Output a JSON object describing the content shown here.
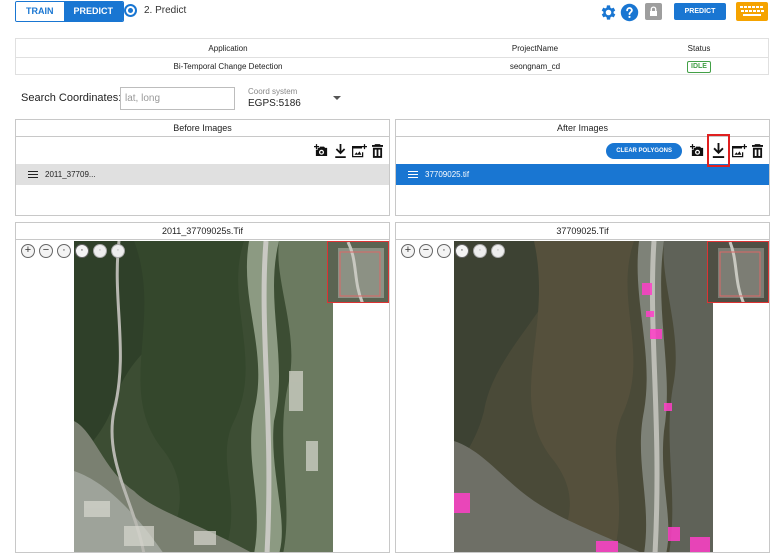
{
  "topbar": {
    "train_label": "TRAIN",
    "predict_toggle_label": "PREDICT",
    "step_label": "2. Predict",
    "predict_button_label": "PREDICT",
    "accent_color": "#1976d2"
  },
  "info_table": {
    "headers": [
      "Application",
      "ProjectName",
      "Status"
    ],
    "application": "Bi-Temporal Change Detection",
    "project_name": "seongnam_cd",
    "status": "IDLE"
  },
  "search": {
    "label": "Search Coordinates:",
    "placeholder": "lat, long",
    "coord_system_label": "Coord system",
    "coord_system_value": "EGPS:5186"
  },
  "before_panel": {
    "title": "Before Images",
    "items": [
      "2011_37709..."
    ]
  },
  "after_panel": {
    "title": "After Images",
    "clear_label": "CLEAR POLYGONS",
    "items": [
      "37709025.tif"
    ]
  },
  "before_map": {
    "title": "2011_37709025s.Tif"
  },
  "after_map": {
    "title": "37709025.Tif"
  },
  "icons": [
    "gear-icon",
    "help-icon",
    "lock-icon",
    "keyboard-icon",
    "add-photo-icon",
    "download-icon",
    "add-image-icon",
    "delete-icon",
    "list-icon",
    "zoom-in-icon",
    "zoom-out-icon"
  ]
}
